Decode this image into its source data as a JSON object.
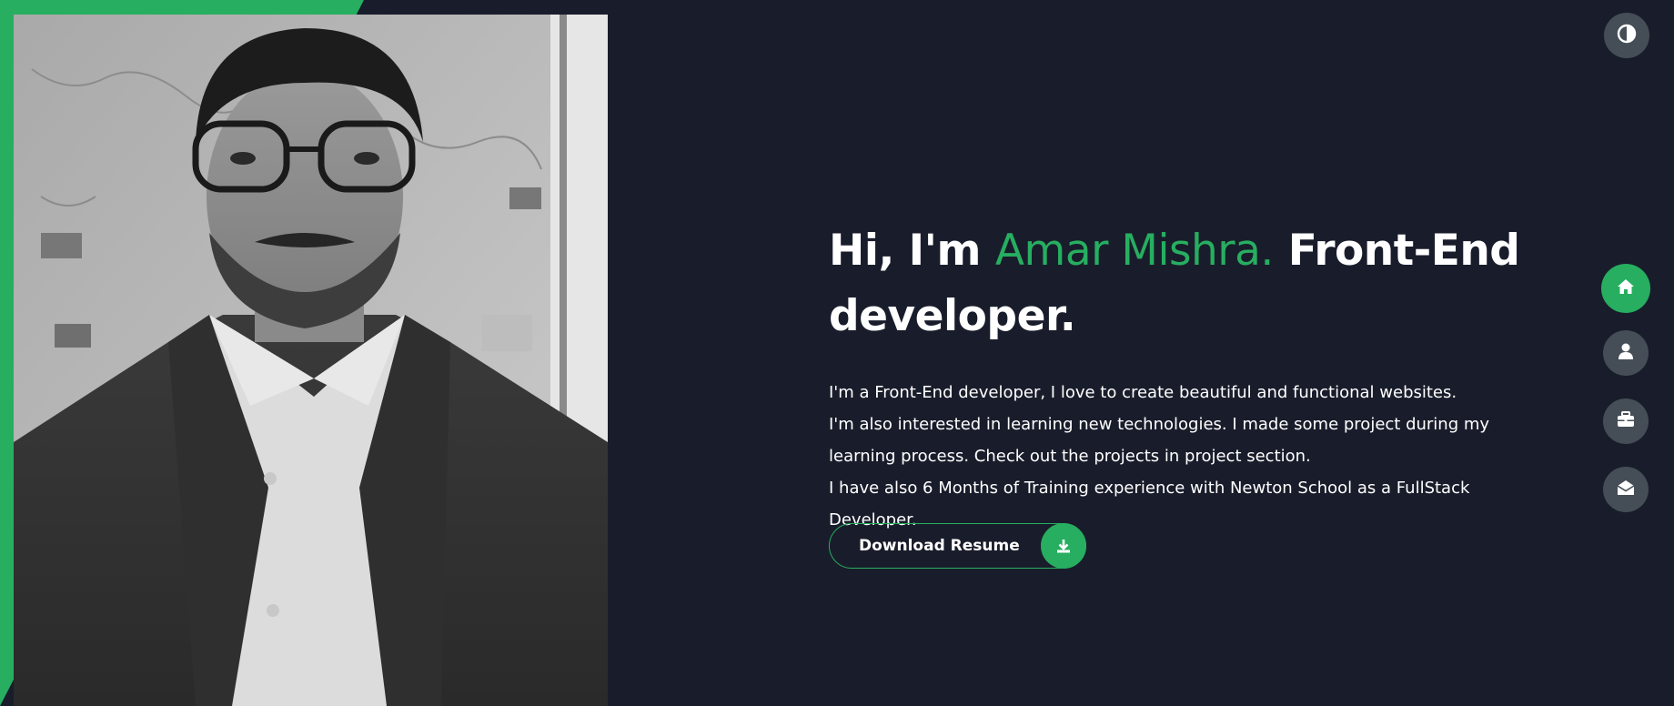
{
  "colors": {
    "background": "#191d2b",
    "accent": "#27ae60",
    "nav_button": "#454e56",
    "text": "#ffffff"
  },
  "hero": {
    "greeting": "Hi, I'm",
    "name": "Amar Mishra.",
    "role": "Front-End developer.",
    "bio_lines": [
      "I'm a Front-End developer, I love to create beautiful and functional websites.",
      "I'm also interested in learning new technologies. I made some project during my learning process. Check out the projects in project section.",
      "I have also 6 Months of Training experience with Newton School as a FullStack Developer."
    ]
  },
  "download_button": {
    "label": "Download Resume",
    "icon": "download-icon"
  },
  "theme_toggle": {
    "icon": "contrast-icon"
  },
  "nav": {
    "items": [
      {
        "icon": "home-icon",
        "active": true
      },
      {
        "icon": "user-icon",
        "active": false
      },
      {
        "icon": "briefcase-icon",
        "active": false
      },
      {
        "icon": "envelope-open-icon",
        "active": false
      }
    ]
  },
  "photo": {
    "subject": "portrait-photo"
  }
}
